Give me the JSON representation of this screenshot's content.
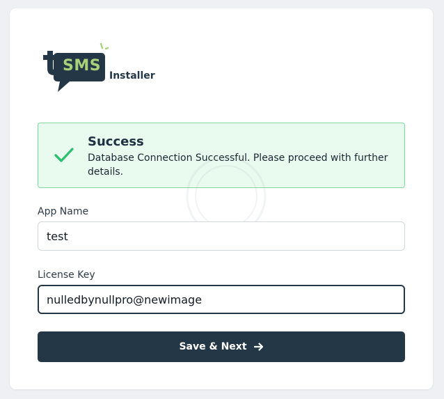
{
  "logo": {
    "letter": "t",
    "brand": "SMS",
    "suffix": "Installer"
  },
  "alert": {
    "title": "Success",
    "message": "Database Connection Successful. Please proceed with further details.",
    "icon": "check-icon"
  },
  "form": {
    "app_name": {
      "label": "App Name",
      "value": "test"
    },
    "license_key": {
      "label": "License Key",
      "value": "nulledbynullpro@newimage"
    },
    "submit_label": "Save & Next",
    "submit_icon": "arrow-right-icon"
  },
  "colors": {
    "primary": "#243746",
    "accent_green": "#a8d17a",
    "success_bg": "#e9fbef",
    "success_border": "#7fd89f",
    "success_check": "#2fbf71"
  }
}
